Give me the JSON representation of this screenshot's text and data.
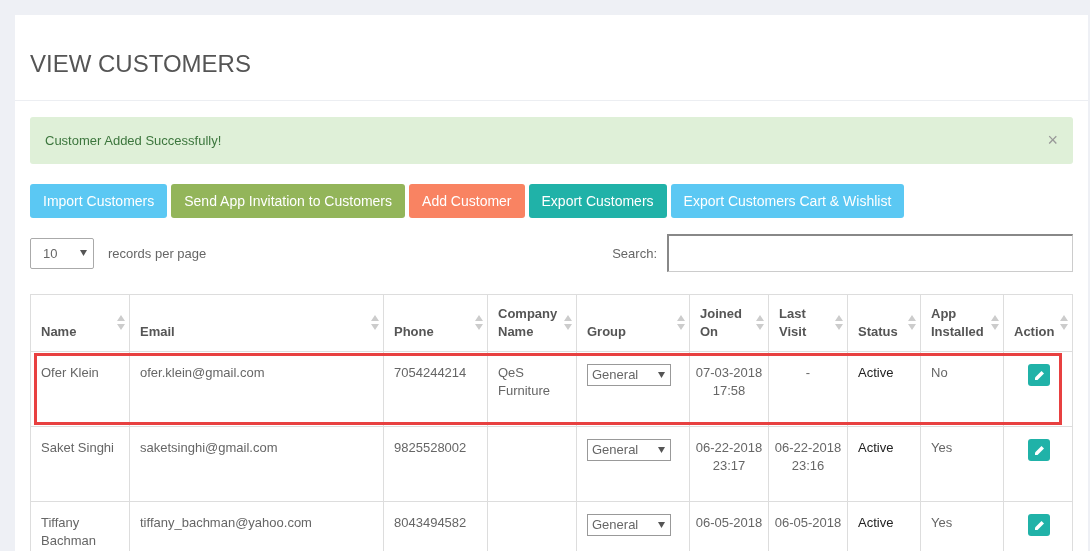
{
  "page": {
    "title": "VIEW CUSTOMERS"
  },
  "alert": {
    "message": "Customer Added Successfully!",
    "close": "×"
  },
  "buttons": [
    {
      "label": "Import Customers",
      "color": "#5bc8f3"
    },
    {
      "label": "Send App Invitation to Customers",
      "color": "#93b55a"
    },
    {
      "label": "Add Customer",
      "color": "#f98362"
    },
    {
      "label": "Export Customers",
      "color": "#20b2a8"
    },
    {
      "label": "Export Customers Cart & Wishlist",
      "color": "#5bc8f3"
    }
  ],
  "length": {
    "value": "10",
    "label": "records per page"
  },
  "search": {
    "label": "Search:"
  },
  "table": {
    "columns": [
      {
        "label": "Name",
        "kind": "text"
      },
      {
        "label": "Email",
        "kind": "text"
      },
      {
        "label": "Phone",
        "kind": "text"
      },
      {
        "label": "Company Name",
        "kind": "text"
      },
      {
        "label": "Group",
        "kind": "select"
      },
      {
        "label": "Joined On",
        "kind": "date"
      },
      {
        "label": "Last Visit",
        "kind": "date"
      },
      {
        "label": "Status",
        "kind": "status"
      },
      {
        "label": "App Installed",
        "kind": "text"
      },
      {
        "label": "Action",
        "kind": "action"
      }
    ],
    "rows": [
      {
        "highlighted": true,
        "cells": [
          "Ofer Klein",
          "ofer.klein@gmail.com",
          "7054244214",
          "QeS Furniture",
          "General",
          "07-03-2018 17:58",
          "-",
          "Active",
          "No",
          null
        ]
      },
      {
        "highlighted": false,
        "cells": [
          "Saket Singhi",
          "saketsinghi@gmail.com",
          "9825528002",
          null,
          "General",
          "06-22-2018 23:17",
          "06-22-2018 23:16",
          "Active",
          "Yes",
          null
        ]
      },
      {
        "highlighted": false,
        "cells": [
          "Tiffany Bachman",
          "tiffany_bachman@yahoo.com",
          "8043494582",
          null,
          "General",
          "06-05-2018",
          "06-05-2018",
          "Active",
          "Yes",
          null
        ]
      }
    ]
  }
}
